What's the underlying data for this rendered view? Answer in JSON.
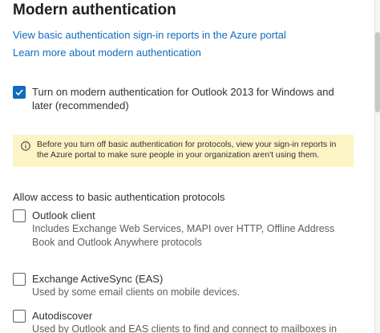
{
  "page": {
    "title": "Modern authentication"
  },
  "links": {
    "view_reports": "View basic authentication sign-in reports in the Azure portal",
    "learn_more": "Learn more about modern authentication"
  },
  "modern_auth": {
    "checked": true,
    "label": "Turn on modern authentication for Outlook 2013 for Windows and later (recommended)"
  },
  "warning": {
    "icon": "info-icon",
    "text": "Before you turn off basic authentication for protocols, view your sign-in reports in the Azure portal to make sure people in your organization aren't using them."
  },
  "protocols": {
    "heading": "Allow access to basic authentication protocols",
    "items": [
      {
        "label": "Outlook client",
        "description": "Includes Exchange Web Services, MAPI over HTTP, Offline Address Book and Outlook Anywhere protocols",
        "checked": false
      },
      {
        "label": "Exchange ActiveSync (EAS)",
        "description": "Used by some email clients on mobile devices.",
        "checked": false
      },
      {
        "label": "Autodiscover",
        "description": "Used by Outlook and EAS clients to find and connect to mailboxes in",
        "checked": false
      }
    ]
  },
  "colors": {
    "accent": "#0f6cbd",
    "warning_bg": "#fcf4c5"
  }
}
